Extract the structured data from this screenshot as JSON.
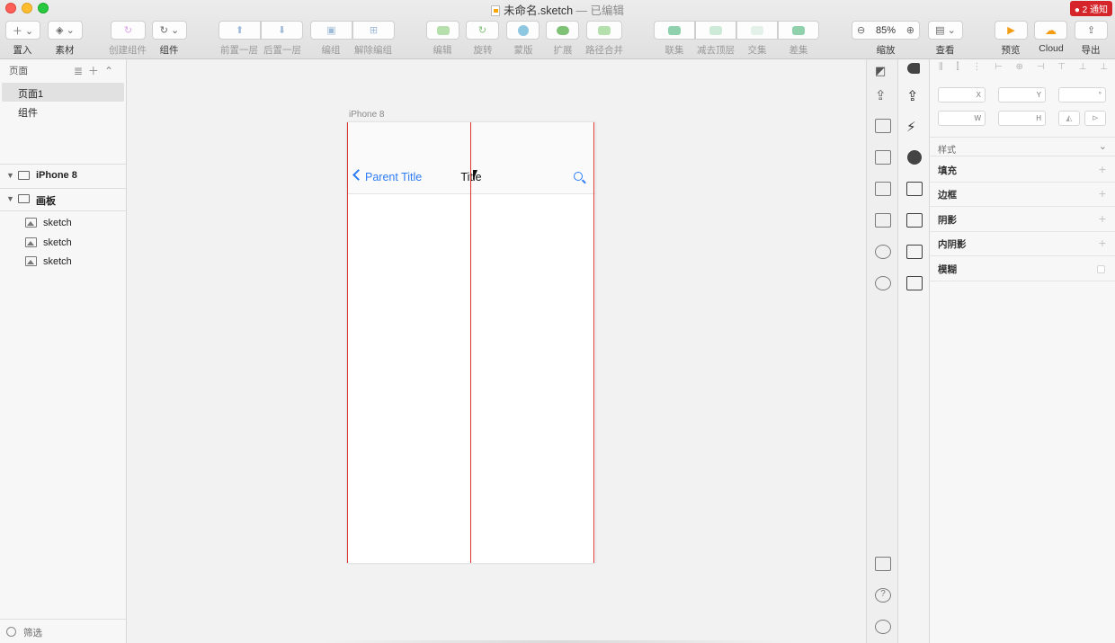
{
  "window": {
    "title_name": "未命名.sketch",
    "title_status": " — 已编辑",
    "notification": "● 2 通知"
  },
  "toolbar": {
    "insert": "置入",
    "assets": "素材",
    "create_symbol": "创建组件",
    "symbol": "组件",
    "forward": "前置一层",
    "backward": "后置一层",
    "group": "编组",
    "ungroup": "解除编组",
    "edit": "编辑",
    "rotate": "旋转",
    "mask": "蒙版",
    "scale": "扩展",
    "flatten": "路径合并",
    "union": "联集",
    "subtract": "减去顶层",
    "intersect": "交集",
    "difference": "差集",
    "zoom_value": "85%",
    "zoom_label": "缩放",
    "view": "查看",
    "preview": "预览",
    "cloud": "Cloud",
    "export": "导出"
  },
  "sidebar": {
    "pages_header": "页面",
    "pages": [
      "页面1",
      "组件"
    ],
    "layers": [
      {
        "name": "iPhone 8"
      },
      {
        "name": "画板"
      },
      {
        "name": "sketch"
      },
      {
        "name": "sketch"
      },
      {
        "name": "sketch"
      }
    ],
    "filter": "筛选"
  },
  "canvas": {
    "artboard_label": "iPhone 8",
    "nav_back": "Parent Title",
    "nav_title": "Title"
  },
  "inspector": {
    "x": "X",
    "y": "Y",
    "rotation": "°",
    "w": "W",
    "h": "H",
    "style_header": "样式",
    "fill": "填充",
    "border": "边框",
    "shadow": "阴影",
    "inner_shadow": "内阴影",
    "blur": "模糊"
  },
  "colors": {
    "ios_blue": "#2d7cf6",
    "guide_red": "#d9362f",
    "notification_red": "#d5252a",
    "preview_orange": "#f7a600"
  }
}
